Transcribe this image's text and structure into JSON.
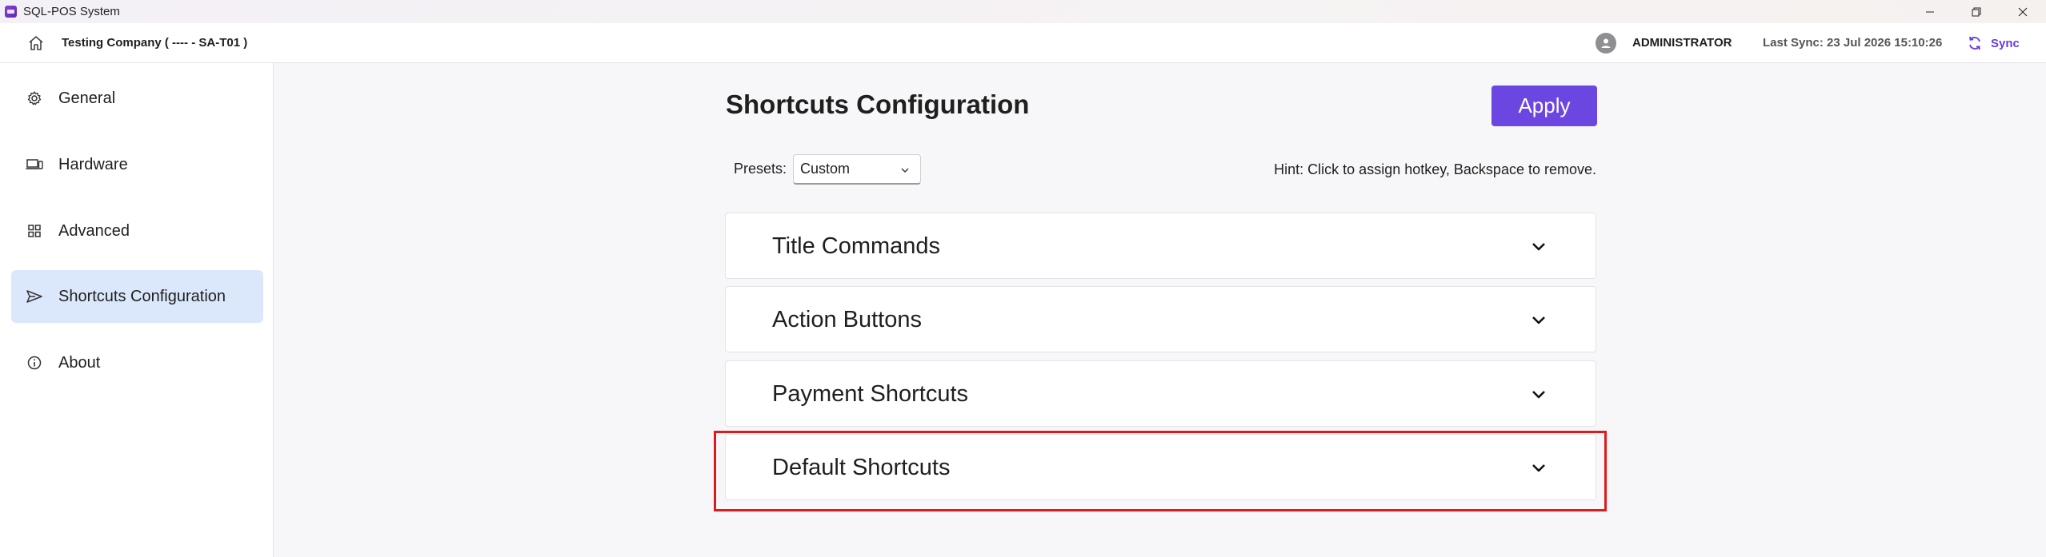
{
  "window": {
    "title": "SQL-POS System"
  },
  "header": {
    "company": "Testing Company ( ---- - SA-T01 )",
    "user": "ADMINISTRATOR",
    "last_sync": "Last Sync: 23 Jul 2026 15:10:26",
    "sync_label": "Sync"
  },
  "sidebar": {
    "items": [
      {
        "label": "General",
        "icon": "gear-icon"
      },
      {
        "label": "Hardware",
        "icon": "hardware-icon"
      },
      {
        "label": "Advanced",
        "icon": "grid-icon"
      },
      {
        "label": "Shortcuts Configuration",
        "icon": "send-icon",
        "active": true
      },
      {
        "label": "About",
        "icon": "info-icon"
      }
    ]
  },
  "main": {
    "title": "Shortcuts Configuration",
    "apply_label": "Apply",
    "presets_label": "Presets:",
    "presets_value": "Custom",
    "hint": "Hint: Click to assign hotkey, Backspace to remove.",
    "sections": [
      {
        "title": "Title Commands"
      },
      {
        "title": "Action Buttons"
      },
      {
        "title": "Payment Shortcuts"
      },
      {
        "title": "Default Shortcuts"
      }
    ]
  },
  "colors": {
    "accent": "#6b46e1",
    "active_nav": "#dbe8fb",
    "highlight": "#e0191c"
  }
}
